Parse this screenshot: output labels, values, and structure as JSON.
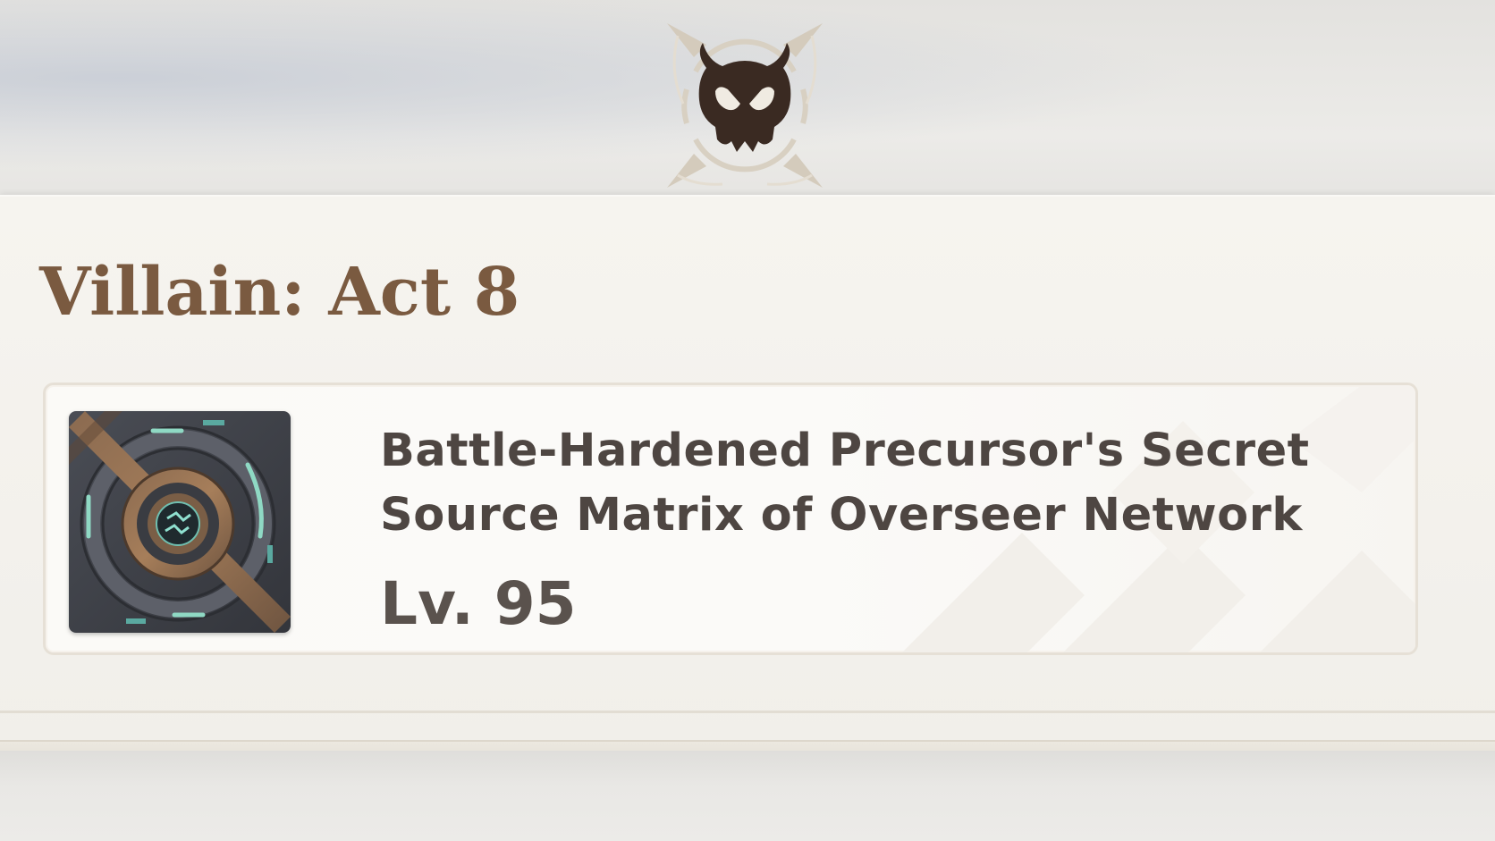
{
  "header": {
    "emblem_icon": "villain-horned-skull-icon"
  },
  "panel": {
    "title": "Villain: Act 8"
  },
  "reward": {
    "icon": "source-matrix-item-icon",
    "name": "Battle-Hardened Precursor's Secret Source Matrix of Overseer Network",
    "level": "Lv. 95"
  },
  "colors": {
    "title": "#7a5a40",
    "emblem": "#3a2a22",
    "item_text": "#4e4642",
    "panel_bg": "#f6f4ef",
    "card_border": "#e6e0d6"
  }
}
